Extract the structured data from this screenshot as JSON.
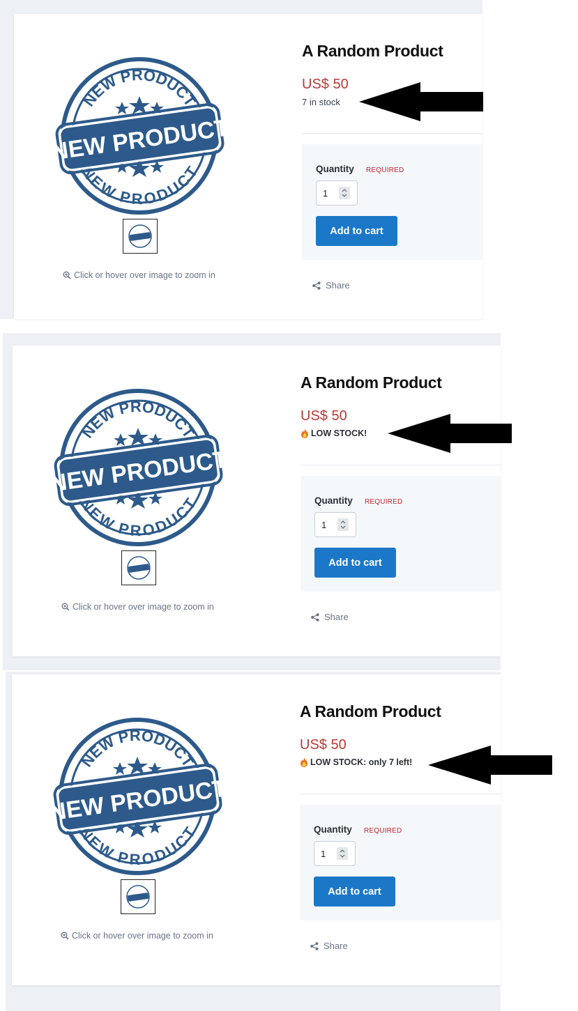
{
  "sections": [
    {
      "title": "A Random Product",
      "price": "US$ 50",
      "stock_text": "7 in stock",
      "stock_style": "plain",
      "quantity_label": "Quantity",
      "required_label": "REQUIRED",
      "quantity_value": "1",
      "add_to_cart_label": "Add to cart",
      "share_label": "Share",
      "zoom_hint": "Click or hover over image to zoom in",
      "stamp_text": "NEW PRODUCT"
    },
    {
      "title": "A Random Product",
      "price": "US$ 50",
      "stock_text": "LOW STOCK!",
      "stock_style": "low",
      "quantity_label": "Quantity",
      "required_label": "REQUIRED",
      "quantity_value": "1",
      "add_to_cart_label": "Add to cart",
      "share_label": "Share",
      "zoom_hint": "Click or hover over image to zoom in",
      "stamp_text": "NEW PRODUCT"
    },
    {
      "title": "A Random Product",
      "price": "US$ 50",
      "stock_text": "LOW STOCK: only 7 left!",
      "stock_style": "low",
      "quantity_label": "Quantity",
      "required_label": "REQUIRED",
      "quantity_value": "1",
      "add_to_cart_label": "Add to cart",
      "share_label": "Share",
      "zoom_hint": "Click or hover over image to zoom in",
      "stamp_text": "NEW PRODUCT"
    }
  ],
  "colors": {
    "price": "#b83a36",
    "accent_button": "#1b78c8",
    "stamp_blue": "#2d5a8a",
    "required": "#c0262d"
  },
  "icons": {
    "zoom": "zoom-in-icon",
    "share": "share-icon",
    "low_stock": "flame-icon",
    "annotation": "arrow-left-icon"
  }
}
